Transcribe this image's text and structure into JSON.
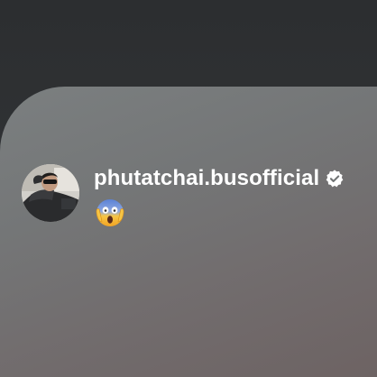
{
  "post": {
    "username": "phutatchai.busofficial",
    "verified": true,
    "message_emoji": "face-screaming-in-fear",
    "avatar": "profile-photo"
  },
  "colors": {
    "background_top": "#2c2e30",
    "card_gradient_start": "#7b7f80",
    "card_gradient_end": "#6d6363",
    "username_text": "#ffffff",
    "verified_badge": "#ffffff"
  }
}
